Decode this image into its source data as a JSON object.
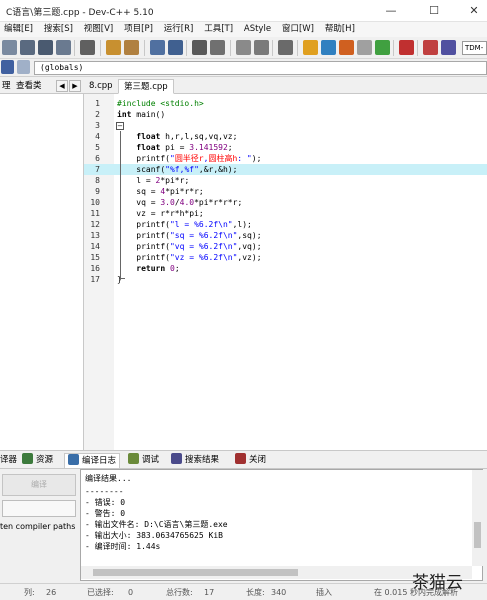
{
  "window": {
    "title": "C语言\\第三题.cpp - Dev-C++ 5.10"
  },
  "menu": [
    "编辑[E]",
    "搜索[S]",
    "视图[V]",
    "项目[P]",
    "运行[R]",
    "工具[T]",
    "AStyle",
    "窗口[W]",
    "帮助[H]"
  ],
  "toolbar": {
    "compiler_combo": "TDM-"
  },
  "toolbar2": {
    "scope_combo": "(globals)"
  },
  "left_panel": {
    "tabs": [
      "理",
      "查看类"
    ],
    "prev_label": "◀",
    "next_label": "▶"
  },
  "editor": {
    "tabs": [
      "8.cpp",
      "第三题.cpp"
    ],
    "active_tab": "第三题.cpp",
    "highlighted_line": 7,
    "lines": [
      "1",
      "2",
      "3",
      "4",
      "5",
      "6",
      "7",
      "8",
      "9",
      "10",
      "11",
      "12",
      "13",
      "14",
      "15",
      "16",
      "17"
    ]
  },
  "bottom_tabs": [
    "译器",
    "资源",
    "编译日志",
    "调试",
    "搜索结果",
    "关闭"
  ],
  "compile_panel": {
    "compile_button": "编译",
    "shorten_label": "ten compiler paths"
  },
  "compile_log": [
    "编译结果...",
    "--------",
    "- 错误: 0",
    "- 警告: 0",
    "- 输出文件名: D:\\C语言\\第三题.exe",
    "- 输出大小: 383.0634765625 KiB",
    "- 编译时间: 1.44s"
  ],
  "status": {
    "col_label": "列:",
    "col_value": "26",
    "sel_label": "已选择:",
    "sel_value": "0",
    "lines_label": "总行数:",
    "lines_value": "17",
    "len_label": "长度:",
    "len_value": "340",
    "mode": "插入",
    "parse": "在 0.015 秒内完成解析"
  },
  "watermark": "茶猫云"
}
